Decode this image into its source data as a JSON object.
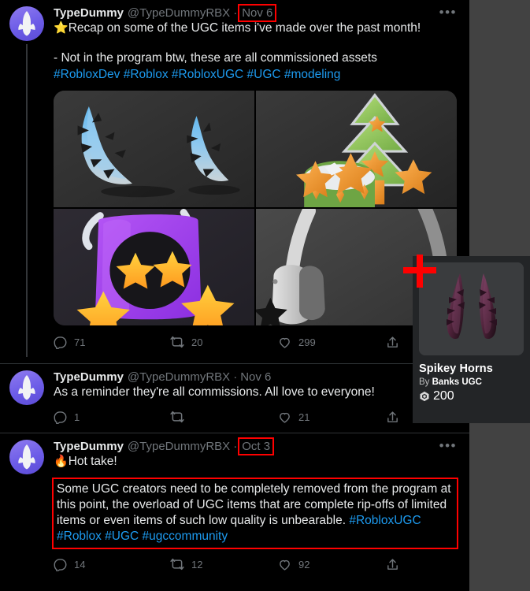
{
  "colors": {
    "background_outer": "#424242",
    "column_background": "#000000",
    "text_primary": "#e7e9ea",
    "text_muted": "#71767b",
    "link": "#1d9bf0",
    "annotation": "#ff0000",
    "avatar_purple": "#6c5ce7",
    "card_background": "#232527"
  },
  "account": {
    "display_name": "TypeDummy",
    "handle": "@TypeDummyRBX",
    "separator": "·",
    "avatar_name": "typedummy-avatar"
  },
  "tweets": [
    {
      "id": "tweet-1",
      "date": "Nov 6",
      "date_annotated": true,
      "text_line1_emoji": "⭐",
      "text_line1": "Recap on some of the UGC items i've made over the past month!",
      "text_line2": "- Not in the program btw, these are all commissioned assets",
      "hashtags": "#RobloxDev #Roblox #RobloxUGC #UGC #modeling",
      "has_media": true,
      "media": [
        {
          "name": "media-ice-spikey-horns",
          "alt": "Blue ice spikey horns"
        },
        {
          "name": "media-christmas-tree-hat",
          "alt": "Green christmas tree hat with orange stars"
        },
        {
          "name": "media-purple-star-hood",
          "alt": "Purple hood character with yellow star eyes"
        },
        {
          "name": "media-star-headphones",
          "alt": "Grey headphones with black star"
        }
      ],
      "actions": {
        "reply_count": "71",
        "retweet_count": "20",
        "like_count": "299",
        "share_count": ""
      },
      "more_label": "•••",
      "show_more": true,
      "thread_line": true
    },
    {
      "id": "tweet-2",
      "date": "Nov 6",
      "date_annotated": false,
      "text_line1_emoji": "",
      "text_line1": "As a reminder they're all commissions. All love to everyone!",
      "text_line2": "",
      "hashtags": "",
      "has_media": false,
      "media": [],
      "actions": {
        "reply_count": "1",
        "retweet_count": "",
        "like_count": "21",
        "share_count": ""
      },
      "more_label": "•••",
      "show_more": false,
      "thread_line": false
    },
    {
      "id": "tweet-3",
      "date": "Oct 3",
      "date_annotated": true,
      "text_line1_emoji": "🔥",
      "text_line1": "Hot take!",
      "boxed_text": "Some UGC creators need to be completely removed from the program at this point, the overload of UGC items that are complete rip-offs of limited items or even items of such low quality is unbearable. ",
      "boxed_hashtags": "#RobloxUGC #Roblox #UGC #ugccommunity",
      "text_annotated": true,
      "has_media": false,
      "media": [],
      "actions": {
        "reply_count": "14",
        "retweet_count": "12",
        "like_count": "92",
        "share_count": ""
      },
      "more_label": "•••",
      "show_more": true,
      "thread_line": false
    }
  ],
  "item_card": {
    "title": "Spikey Horns",
    "by_label": "By",
    "creator": "Banks UGC",
    "price": "200",
    "currency_icon": "robux-icon",
    "thumbnail_name": "spikey-horns-thumbnail"
  },
  "cursor": {
    "name": "crosshair-plus-cursor",
    "color": "#ff0000"
  },
  "icons": {
    "reply": "reply-icon",
    "retweet": "retweet-icon",
    "like": "heart-icon",
    "share": "share-icon",
    "more": "more-options-icon"
  }
}
